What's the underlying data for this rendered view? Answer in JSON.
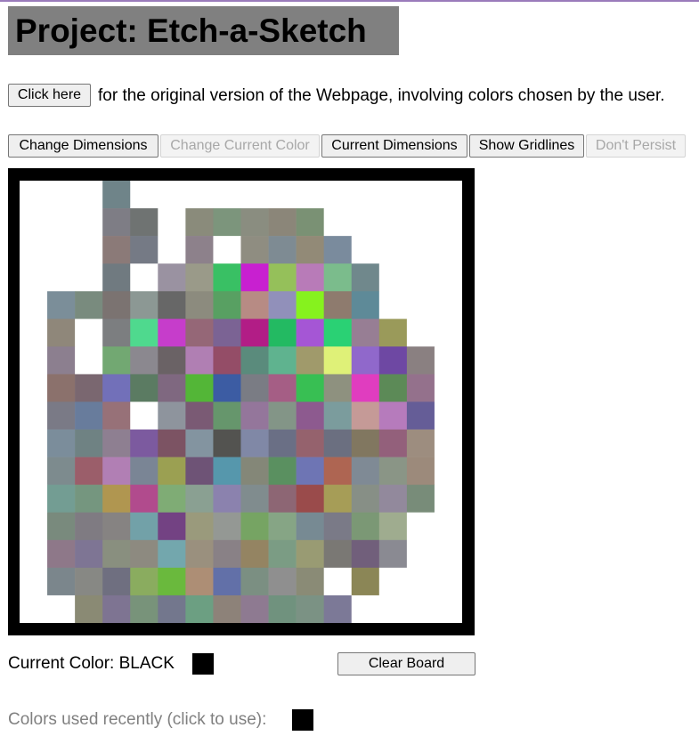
{
  "header": {
    "title": "Project: Etch-a-Sketch"
  },
  "intro": {
    "button_label": "Click here",
    "text": "for the original version of the Webpage, involving colors chosen by the user."
  },
  "toolbar": {
    "change_dimensions": "Change Dimensions",
    "change_current_color": "Change Current Color",
    "current_dimensions": "Current Dimensions",
    "show_gridlines": "Show Gridlines",
    "dont_persist": "Don't Persist"
  },
  "board": {
    "rows": 16,
    "cols": 16,
    "background": "#ffffff",
    "frame_color": "#000000",
    "cells": [
      [
        null,
        null,
        null,
        "#6f8489",
        null,
        null,
        null,
        null,
        null,
        null,
        null,
        null,
        null,
        null,
        null,
        null
      ],
      [
        null,
        null,
        null,
        "#7e7d85",
        "#6f7372",
        null,
        "#8a8b7b",
        "#7c957c",
        "#8a8d80",
        "#8b8679",
        "#7a9174",
        null,
        null,
        null,
        null,
        null
      ],
      [
        null,
        null,
        null,
        "#8b7a78",
        "#757a85",
        null,
        "#8d818b",
        null,
        "#8f8d81",
        "#7e8b93",
        "#928a77",
        "#7a8b9d",
        null,
        null,
        null,
        null
      ],
      [
        null,
        null,
        null,
        "#707a80",
        null,
        "#9a92a1",
        "#9a9a89",
        "#39c064",
        "#c820d0",
        "#95c05a",
        "#b87bb8",
        "#7bbc8c",
        "#70888c",
        null,
        null,
        null
      ],
      [
        null,
        "#7b8e99",
        "#798b7e",
        "#7b7371",
        "#8c9894",
        "#676767",
        "#8c8b7e",
        "#58a062",
        "#b78b84",
        "#9190ba",
        "#86f21e",
        "#8e7b6e",
        "#5e8a98",
        null,
        null,
        null
      ],
      [
        null,
        "#8f877a",
        null,
        "#7c7e80",
        "#4fd98e",
        "#c63dcb",
        "#956777",
        "#7b6394",
        "#b21d86",
        "#23ba62",
        "#a556d5",
        "#2ad174",
        "#977e94",
        "#9a9a5a",
        null,
        null
      ],
      [
        null,
        "#8c7f8f",
        null,
        "#72a872",
        "#8b888f",
        "#6a6265",
        "#b07fb3",
        "#944d67",
        "#5a8b7c",
        "#5fb38f",
        "#a09a6b",
        "#dff178",
        "#9068cb",
        "#6e48a3",
        "#8a8081",
        null
      ],
      [
        null,
        "#8b716c",
        "#7a6770",
        "#7270b9",
        "#5b7b62",
        "#7f6880",
        "#53b637",
        "#3c5ca3",
        "#7a7c84",
        "#a55e85",
        "#38bf53",
        "#8e917f",
        "#e03dbf",
        "#5c8a57",
        "#94718c",
        null
      ],
      [
        null,
        "#7a7a86",
        "#687c9c",
        "#977178",
        "#ffffff",
        "#8e949d",
        "#7a5a74",
        "#66966c",
        "#94769b",
        "#839587",
        "#8d5a8f",
        "#7b9c9d",
        "#c59a97",
        "#b67bbc",
        "#655d97",
        null
      ],
      [
        null,
        "#7b8d9b",
        "#6f8283",
        "#8e7f91",
        "#7c5a9f",
        "#7c5363",
        "#8394a0",
        "#535350",
        "#8088a6",
        "#6a6f85",
        "#95626d",
        "#6b6f80",
        "#817760",
        "#93607b",
        "#9d8d7f",
        null
      ],
      [
        null,
        "#7d8b8e",
        "#9b5e6a",
        "#b17fb4",
        "#7a8595",
        "#9ba052",
        "#6e5376",
        "#5697ac",
        "#848778",
        "#5a9060",
        "#6e75b4",
        "#ae6552",
        "#7f8a95",
        "#8a9586",
        "#9c8a7b",
        null
      ],
      [
        null,
        "#739d93",
        "#75967f",
        "#b09650",
        "#b14b8d",
        "#7fac75",
        "#8aa092",
        "#8b82ae",
        "#808c8e",
        "#8d6674",
        "#9a4b4b",
        "#a69d57",
        "#878f86",
        "#92899c",
        "#788c79",
        null
      ],
      [
        null,
        "#798a7d",
        "#7f7b82",
        "#868382",
        "#72a1a8",
        "#734283",
        "#9a9a7c",
        "#949894",
        "#76a463",
        "#86a585",
        "#778a93",
        "#7a7a87",
        "#7b9875",
        "#9fac8f",
        null,
        null
      ],
      [
        null,
        "#8e7889",
        "#7e7594",
        "#898f7f",
        "#8d8a80",
        "#73a7ad",
        "#9a907e",
        "#898186",
        "#948462",
        "#7b9c84",
        "#999b73",
        "#7a7874",
        "#715f7b",
        "#8a8a92",
        null,
        null
      ],
      [
        null,
        "#7b868c",
        "#878884",
        "#6f6f80",
        "#8aac5f",
        "#6ab93d",
        "#ad8e75",
        "#6270a8",
        "#7b8f82",
        "#8f8f8f",
        "#8a8b76",
        null,
        "#8b8656",
        null,
        null,
        null
      ],
      [
        null,
        null,
        "#8a8a74",
        "#7e7492",
        "#78937a",
        "#73778d",
        "#6c9f82",
        "#8d8279",
        "#8e7a91",
        "#70927e",
        "#7b9284",
        "#7c7997",
        null,
        null,
        null,
        null
      ]
    ]
  },
  "current_color": {
    "label": "Current Color: BLACK",
    "value": "#000000"
  },
  "clear_board": {
    "label": "Clear Board"
  },
  "recent_colors": {
    "label": "Colors used recently (click to use):",
    "colors": [
      "#000000"
    ]
  }
}
